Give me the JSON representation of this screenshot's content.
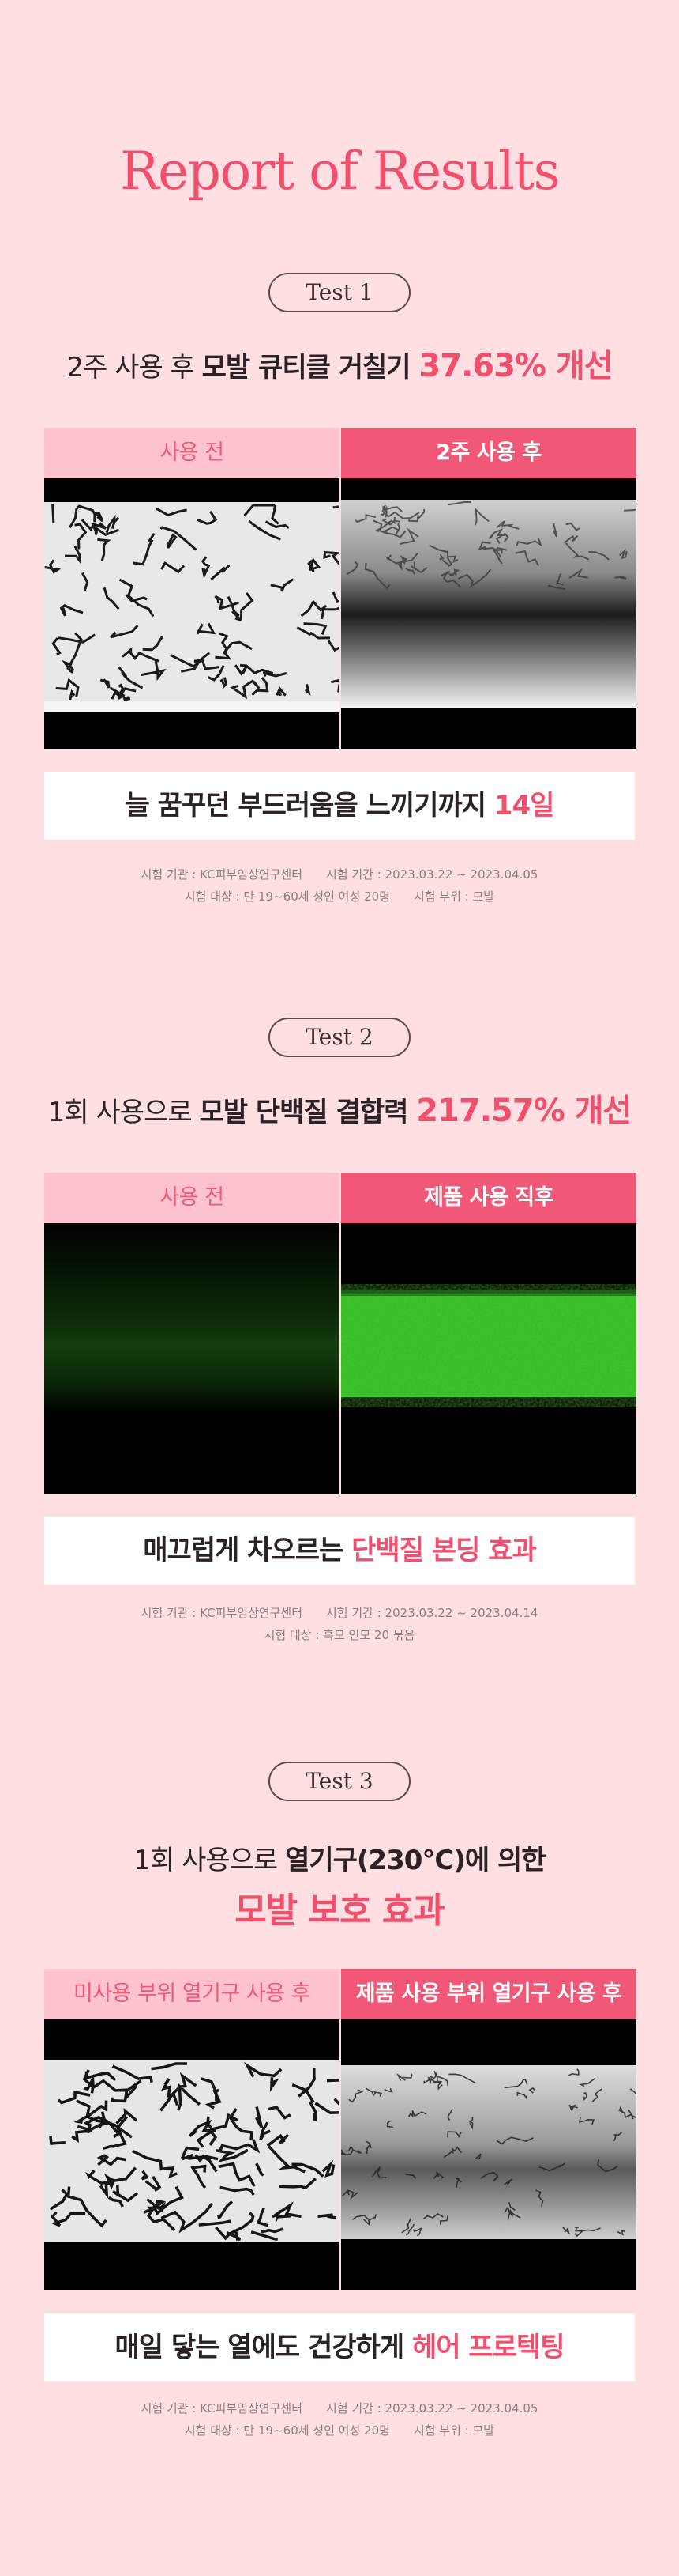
{
  "title": "Report of Results",
  "tests": [
    {
      "label": "Test 1",
      "headline_pre": "2주 사용 후 ",
      "headline_bold": "모발 큐티클 거칠기 ",
      "headline_accent": "37.63% 개선",
      "before_label": "사용 전",
      "after_label": "2주 사용 후",
      "summary_pre": "늘 꿈꾸던 부드러움을 느끼기까지 ",
      "summary_accent": "14일",
      "note_line1_a": "시험 기관 : KC피부임상연구센터",
      "note_line1_b": "시험 기간 : 2023.03.22 ~ 2023.04.05",
      "note_line2_a": "시험 대상 : 만 19~60세 성인 여성 20명",
      "note_line2_b": "시험 부위 : 모발"
    },
    {
      "label": "Test 2",
      "headline_pre": "1회 사용으로 ",
      "headline_bold": "모발 단백질 결합력 ",
      "headline_accent": "217.57% 개선",
      "before_label": "사용 전",
      "after_label": "제품 사용 직후",
      "summary_pre": "매끄럽게 차오르는 ",
      "summary_accent": "단백질 본딩 효과",
      "note_line1_a": "시험 기관 : KC피부임상연구센터",
      "note_line1_b": "시험 기간 : 2023.03.22 ~ 2023.04.14",
      "note_line2_a": "시험 대상 : 흑모 인모 20 묶음",
      "note_line2_b": ""
    },
    {
      "label": "Test 3",
      "headline_pre": "1회 사용으로 ",
      "headline_bold": "열기구(230°C)에 의한",
      "headline_accent": "",
      "headline2": "모발 보호 효과",
      "before_label": "미사용 부위 열기구 사용 후",
      "after_label": "제품 사용 부위 열기구 사용 후",
      "summary_pre": "매일 닿는 열에도 건강하게 ",
      "summary_accent": "헤어 프로텍팅",
      "note_line1_a": "시험 기관 : KC피부임상연구센터",
      "note_line1_b": "시험 기간 : 2023.03.22 ~ 2023.04.05",
      "note_line2_a": "시험 대상 : 만 19~60세 성인 여성 20명",
      "note_line2_b": "시험 부위 : 모발"
    }
  ],
  "colors": {
    "background": "#ffdfe1",
    "accent": "#f0506e",
    "before_label_bg": "#ffc2cf",
    "after_label_bg": "#f15877",
    "fluorescence": "#29c21e"
  }
}
